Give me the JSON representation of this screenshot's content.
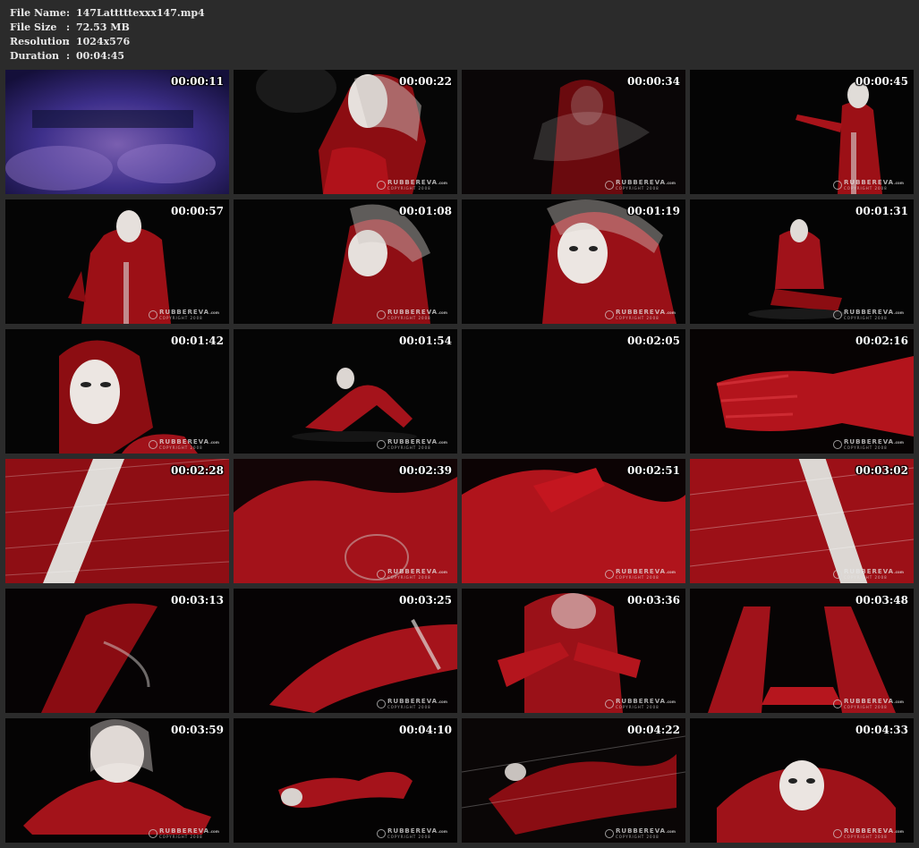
{
  "file_info": {
    "name_label": "File Name",
    "name_value": "147Latttttexxx147.mp4",
    "size_label": "File Size",
    "size_value": "72.53 MB",
    "resolution_label": "Resolution",
    "resolution_value": "1024x576",
    "duration_label": "Duration",
    "duration_value": "00:04:45",
    "separator": ":"
  },
  "watermark": {
    "brand": "RUBBEREVA",
    "brand_suffix": ".com",
    "copyright": "COPYRIGHT 2008"
  },
  "thumbnails": [
    {
      "timestamp": "00:00:11",
      "scene": "purple-blur",
      "watermark": false
    },
    {
      "timestamp": "00:00:22",
      "scene": "masked-hood-closeup",
      "watermark": true
    },
    {
      "timestamp": "00:00:34",
      "scene": "figure-behind-plastic",
      "watermark": true
    },
    {
      "timestamp": "00:00:45",
      "scene": "standing-figure",
      "watermark": true
    },
    {
      "timestamp": "00:00:57",
      "scene": "standing-figure-hood",
      "watermark": true
    },
    {
      "timestamp": "00:01:08",
      "scene": "masked-hood-profile",
      "watermark": true
    },
    {
      "timestamp": "00:01:19",
      "scene": "masked-face-closeup",
      "watermark": true
    },
    {
      "timestamp": "00:01:31",
      "scene": "kneeling-figure",
      "watermark": true
    },
    {
      "timestamp": "00:01:42",
      "scene": "mask-portrait",
      "watermark": true
    },
    {
      "timestamp": "00:01:54",
      "scene": "crawling-figure",
      "watermark": true
    },
    {
      "timestamp": "00:02:05",
      "scene": "black",
      "watermark": false
    },
    {
      "timestamp": "00:02:16",
      "scene": "red-glove-hand",
      "watermark": true
    },
    {
      "timestamp": "00:02:28",
      "scene": "wrapped-stripe",
      "watermark": false
    },
    {
      "timestamp": "00:02:39",
      "scene": "red-curves",
      "watermark": true
    },
    {
      "timestamp": "00:02:51",
      "scene": "red-glove-body",
      "watermark": true
    },
    {
      "timestamp": "00:03:02",
      "scene": "wrapped-diagonal",
      "watermark": true
    },
    {
      "timestamp": "00:03:13",
      "scene": "red-limb-dark",
      "watermark": false
    },
    {
      "timestamp": "00:03:25",
      "scene": "wrapped-leg",
      "watermark": true
    },
    {
      "timestamp": "00:03:36",
      "scene": "hands-on-hood",
      "watermark": true
    },
    {
      "timestamp": "00:03:48",
      "scene": "kneeling-closeup",
      "watermark": true
    },
    {
      "timestamp": "00:03:59",
      "scene": "crawl-mask",
      "watermark": true
    },
    {
      "timestamp": "00:04:10",
      "scene": "lying-figure",
      "watermark": true
    },
    {
      "timestamp": "00:04:22",
      "scene": "lying-plastic",
      "watermark": true
    },
    {
      "timestamp": "00:04:33",
      "scene": "mask-floor",
      "watermark": true
    }
  ]
}
